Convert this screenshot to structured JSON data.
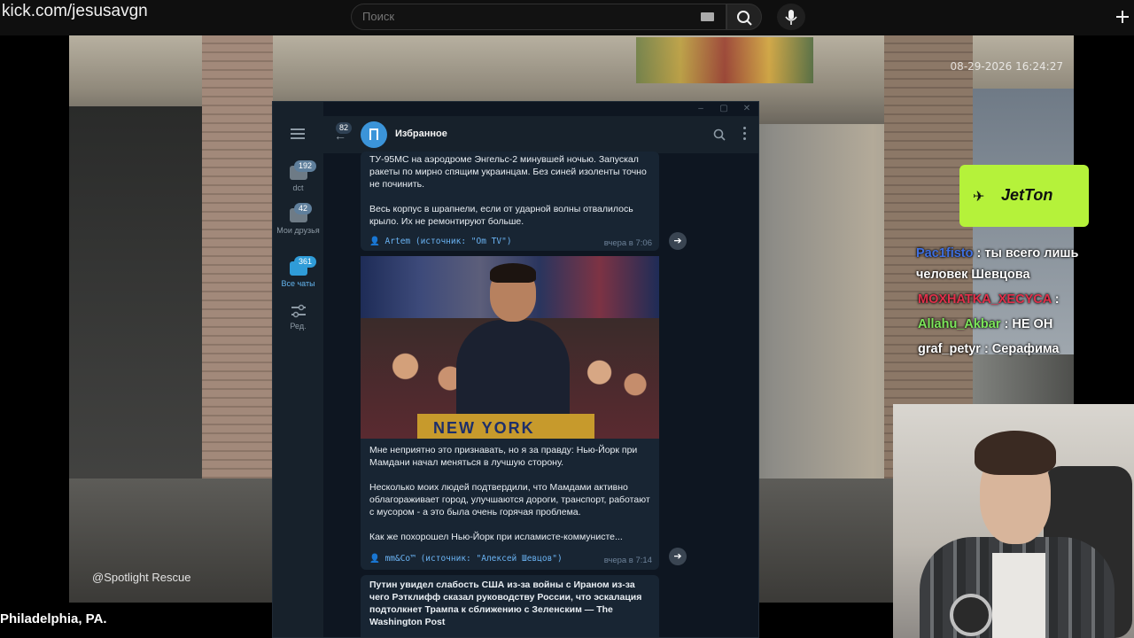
{
  "browser": {
    "url_text": "kick.com/jesusavgn",
    "search_placeholder": "Поиск"
  },
  "stream": {
    "timestamp": "08-29-2026 16:24:27",
    "watermark": "@Spotlight Rescue",
    "location": "Philadelphia, PA."
  },
  "telegram": {
    "sidebar": {
      "folders": [
        {
          "label": "dct",
          "badge": "192"
        },
        {
          "label": "Мои друзья",
          "badge": "42"
        },
        {
          "label": "Все чаты",
          "badge": "361"
        },
        {
          "label": "Ред.",
          "badge": ""
        }
      ]
    },
    "header": {
      "back_badge": "82",
      "title": "Избранное"
    },
    "messages": [
      {
        "text": "ТУ-95МС на аэродроме Энгельс-2 минувшей ночью. Запускал ракеты по мирно спящим украинцам. Без синей изоленты точно не починить.\n\nВесь корпус в шрапнели, если от ударной волны отвалилось крыло. Их не ремонтируют больше.",
        "source": "👤 Artem (источник: \"Om TV\")",
        "time": "вчера в 7:06"
      },
      {
        "photo_caption": "NEW YORK",
        "text": "Мне неприятно это признавать, но я за правду: Нью-Йорк при Мамдани начал меняться в лучшую сторону.\n\nНесколько моих людей подтвердили, что Мамдами активно облагораживает город, улучшаются дороги, транспорт, работают с мусором - а это была очень горячая проблема.\n\nКак же похорошел Нью-Йорк при исламисте-коммунисте...",
        "source": "👤 mm&Co™ (источник: \"Алексей Шевцов\")",
        "time": "вчера в 7:14"
      },
      {
        "text": "Путин увидел слабость США из-за войны с Ираном из-за чего Рэтклифф сказал руководству России, что эскалация подтолкнет Трампа к сближению с Зеленским — The Washington Post"
      }
    ]
  },
  "overlay": {
    "sponsor": "JetTon",
    "chat": [
      {
        "user": "Pac1fisto",
        "text": ": ты всего лишь",
        "continuation": "человек Шевцова",
        "color": "#3f6fe0"
      },
      {
        "user": "MOXHATKA_XECYCA",
        "text": ":",
        "color": "#e0304a"
      },
      {
        "user": "Allahu_Akbar",
        "text": ": НЕ ОН",
        "color": "#7ce65a"
      },
      {
        "user": "graf_petyr",
        "text": ": Серафима",
        "color": "#ffffff"
      }
    ]
  }
}
